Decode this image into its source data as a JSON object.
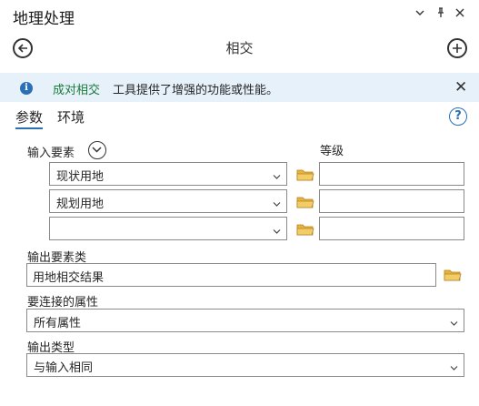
{
  "pane": {
    "title": "地理处理",
    "dropdown_icon": "chevron-down-icon",
    "pin_icon": "pin-icon",
    "close_icon": "close-icon"
  },
  "tool": {
    "title": "相交",
    "back_icon": "back-arrow-icon",
    "add_icon": "add-icon"
  },
  "info": {
    "icon": "info-icon",
    "link": "成对相交",
    "text": "工具提供了增强的功能或性能。",
    "close_icon": "close-icon"
  },
  "tabs": {
    "params": "参数",
    "env": "环境",
    "help_icon": "help-icon"
  },
  "form": {
    "input_features_label": "输入要素",
    "rank_label": "等级",
    "input_rows": [
      {
        "value": "现状用地",
        "rank": ""
      },
      {
        "value": "规划用地",
        "rank": ""
      },
      {
        "value": "",
        "rank": ""
      }
    ],
    "output_label": "输出要素类",
    "output_value": "用地相交结果",
    "join_label": "要连接的属性",
    "join_value": "所有属性",
    "type_label": "输出类型",
    "type_value": "与输入相同"
  },
  "colors": {
    "accent": "#2b6fb5",
    "info_bg": "#e6f1fa",
    "link_green": "#1a7a3c",
    "folder": "#e8b33c"
  }
}
